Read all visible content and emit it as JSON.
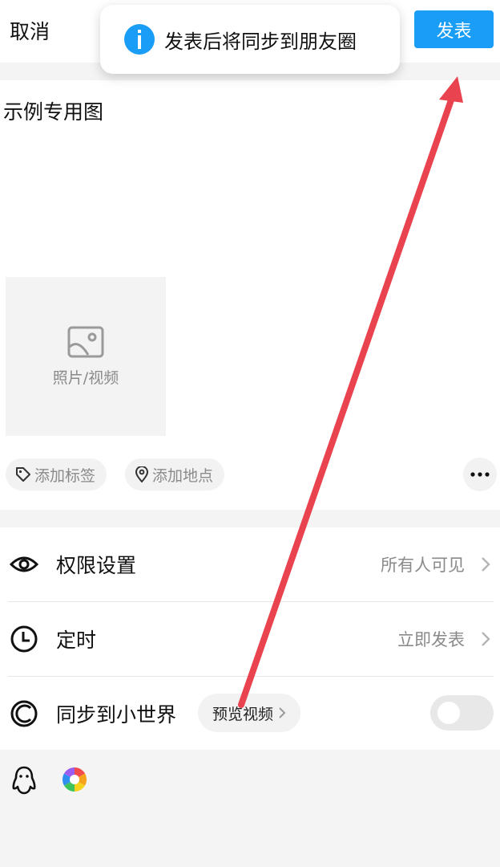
{
  "topbar": {
    "cancel_label": "取消",
    "publish_label": "发表"
  },
  "toast": {
    "message": "发表后将同步到朋友圈",
    "icon": "info-icon"
  },
  "post": {
    "text": "示例专用图",
    "media_label": "照片/视频"
  },
  "chips": {
    "tag_label": "添加标签",
    "location_label": "添加地点"
  },
  "settings": {
    "permission": {
      "label": "权限设置",
      "value": "所有人可见"
    },
    "schedule": {
      "label": "定时",
      "value": "立即发表"
    },
    "sync": {
      "label": "同步到小世界",
      "preview_label": "预览视频",
      "enabled": false
    }
  },
  "colors": {
    "accent": "#1a9df6",
    "annotation_arrow": "#e8434f"
  }
}
